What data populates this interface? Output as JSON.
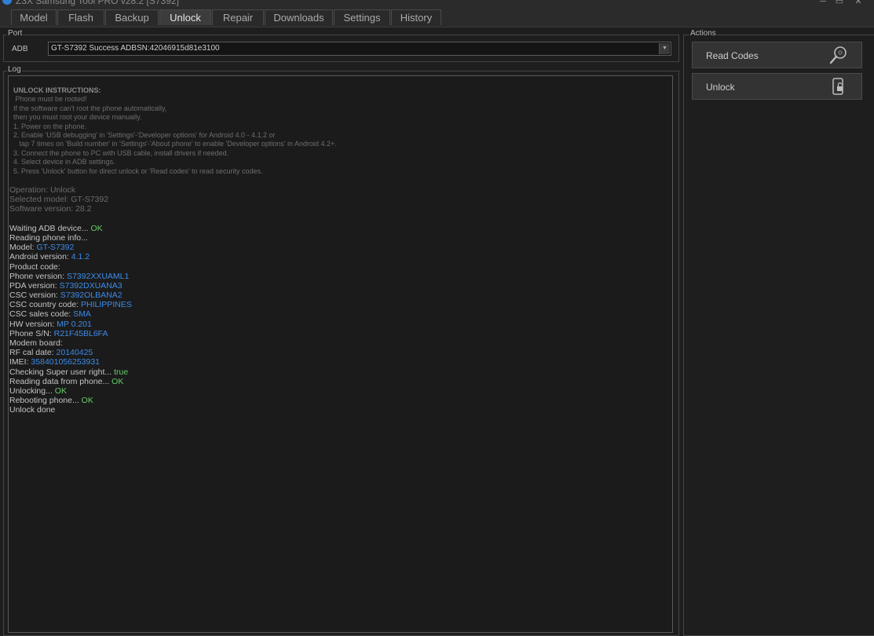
{
  "window": {
    "title": "Z3X Samsung Tool PRO v28.2 [S7392]",
    "minimize": "─",
    "maximize": "▭",
    "close": "✕"
  },
  "tabs": [
    {
      "label": "Model"
    },
    {
      "label": "Flash"
    },
    {
      "label": "Backup"
    },
    {
      "label": "Unlock"
    },
    {
      "label": "Repair"
    },
    {
      "label": "Downloads"
    },
    {
      "label": "Settings"
    },
    {
      "label": "History"
    }
  ],
  "active_tab": "Unlock",
  "port": {
    "group_label": "Port",
    "label": "ADB",
    "selected": "GT-S7392 Success ADBSN:42046915d81e3100",
    "arrow": "▼"
  },
  "log": {
    "group_label": "Log",
    "instructions": {
      "header": "UNLOCK INSTRUCTIONS:",
      "lines": [
        " Phone must be rooted!",
        "If the software can't root the phone automatically,",
        "then you must root your device manually.",
        "1. Power on the phone.",
        "2. Enable 'USB debugging' in 'Settings'-'Developer options' for Android 4.0 - 4.1.2 or",
        "   tap 7 times on 'Build number' in 'Settings'-'About phone' to enable 'Developer options' in Android 4.2+.",
        "3. Connect the phone to PC with USB cable, install drivers if needed.",
        "4. Select device in ADB settings.",
        "5. Press 'Unlock' button for direct unlock or 'Read codes' to read security codes."
      ]
    },
    "operation": [
      "Operation: Unlock",
      "Selected model: GT-S7392",
      "Software version: 28.2"
    ],
    "entries": [
      {
        "label": "Waiting ADB device... ",
        "value": "OK",
        "type": "ok"
      },
      {
        "label": "Reading phone info...",
        "value": "",
        "type": "none"
      },
      {
        "label": "Model: ",
        "value": "GT-S7392",
        "type": "blue"
      },
      {
        "label": "Android version: ",
        "value": "4.1.2",
        "type": "blue"
      },
      {
        "label": "Product code:",
        "value": "",
        "type": "none"
      },
      {
        "label": "Phone version: ",
        "value": "S7392XXUAML1",
        "type": "blue"
      },
      {
        "label": "PDA version: ",
        "value": "S7392DXUANA3",
        "type": "blue"
      },
      {
        "label": "CSC version: ",
        "value": "S7392OLBANA2",
        "type": "blue"
      },
      {
        "label": "CSC country code: ",
        "value": "PHILIPPINES",
        "type": "blue"
      },
      {
        "label": "CSC sales code: ",
        "value": "SMA",
        "type": "blue"
      },
      {
        "label": "HW version: ",
        "value": "MP 0.201",
        "type": "blue"
      },
      {
        "label": "Phone S/N: ",
        "value": "R21F45BL6FA",
        "type": "blue"
      },
      {
        "label": "Modem board:",
        "value": "",
        "type": "none"
      },
      {
        "label": "RF cal date: ",
        "value": "20140425",
        "type": "blue"
      },
      {
        "label": "IMEI: ",
        "value": "358401056253931",
        "type": "blue"
      },
      {
        "label": "Checking Super user right... ",
        "value": "true",
        "type": "ok"
      },
      {
        "label": "Reading data from phone... ",
        "value": "OK",
        "type": "ok"
      },
      {
        "label": "Unlocking... ",
        "value": "OK",
        "type": "ok"
      },
      {
        "label": "Rebooting phone... ",
        "value": "OK",
        "type": "ok"
      },
      {
        "label": "Unlock done",
        "value": "",
        "type": "none"
      }
    ]
  },
  "actions": {
    "group_label": "Actions",
    "read_codes": "Read Codes",
    "unlock": "Unlock"
  },
  "colors": {
    "ok": "#66cc66",
    "value": "#3d8be8",
    "background": "#1e1e1e"
  }
}
